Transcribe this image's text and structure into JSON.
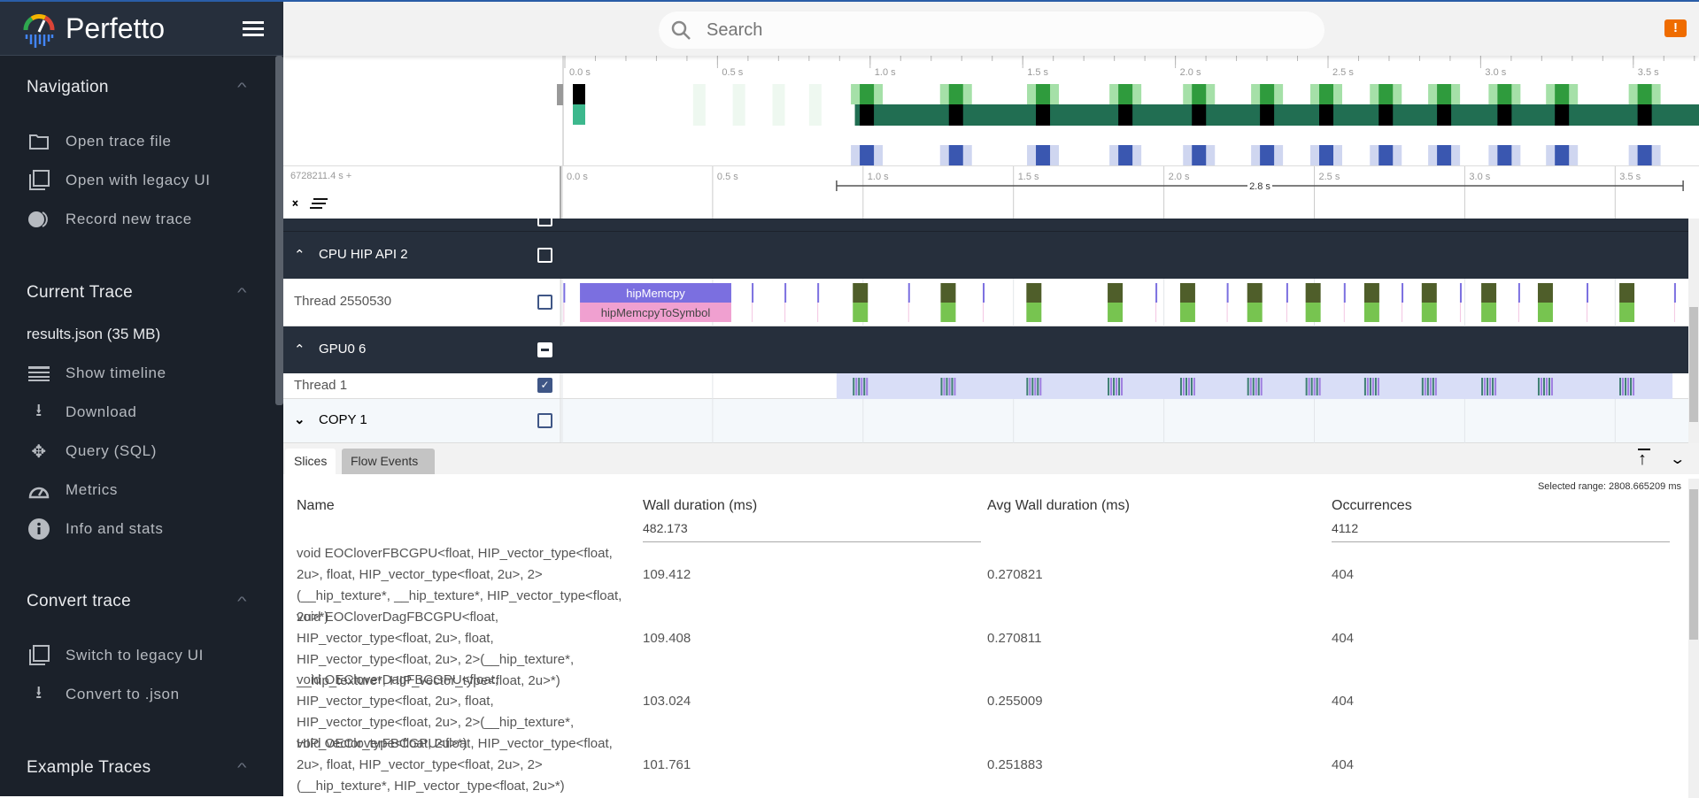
{
  "app": {
    "title": "Perfetto",
    "search_placeholder": "Search",
    "alert_icon": "alert-icon"
  },
  "colors": {
    "sidebar_bg": "#1b212a",
    "track_header_bg": "#262f3c",
    "accent": "#2a5ea8",
    "alert": "#ef6c00",
    "slice_purple": "#7b6fe0",
    "slice_pink": "#f0a0d0",
    "slice_olive": "#4f5e2a",
    "slice_green": "#77c450",
    "overview_teal": "#216e52",
    "overview_blue": "#3a57b0"
  },
  "sidebar": {
    "sections": [
      {
        "title": "Navigation",
        "items": [
          {
            "label": "Open trace file",
            "icon": "folder-icon"
          },
          {
            "label": "Open with legacy UI",
            "icon": "copy-icon"
          },
          {
            "label": "Record new trace",
            "icon": "record-icon"
          }
        ]
      },
      {
        "title": "Current Trace",
        "subtitle": "results.json (35 MB)",
        "items": [
          {
            "label": "Show timeline",
            "icon": "timeline-icon"
          },
          {
            "label": "Download",
            "icon": "download-icon"
          },
          {
            "label": "Query (SQL)",
            "icon": "query-icon"
          },
          {
            "label": "Metrics",
            "icon": "speedometer-icon"
          },
          {
            "label": "Info and stats",
            "icon": "info-icon"
          }
        ]
      },
      {
        "title": "Convert trace",
        "items": [
          {
            "label": "Switch to legacy UI",
            "icon": "copy-icon"
          },
          {
            "label": "Convert to .json",
            "icon": "download-icon"
          }
        ]
      },
      {
        "title": "Example Traces",
        "items": []
      }
    ]
  },
  "timeline": {
    "offset_label": "6728211.4 s +",
    "ticks": [
      "0.0 s",
      "0.5 s",
      "1.0 s",
      "1.5 s",
      "2.0 s",
      "2.5 s",
      "3.0 s",
      "3.5 s"
    ],
    "selection_label": "2.8 s",
    "selection_range_s": [
      0.912,
      3.726
    ],
    "tracks": [
      {
        "name": "CPU HIP API 2",
        "type": "group",
        "expanded": true,
        "checked": false
      },
      {
        "name": "Thread 2550530",
        "type": "thread",
        "checked": false
      },
      {
        "name": "GPU0 6",
        "type": "group",
        "expanded": true,
        "checked": "partial"
      },
      {
        "name": "Thread 1",
        "type": "thread",
        "checked": true
      },
      {
        "name": "COPY 1",
        "type": "group",
        "expanded": false,
        "checked": false
      }
    ],
    "thread_slices": {
      "main": [
        {
          "name": "hipMemcpy",
          "child": "hipMemcpyToSymbol",
          "start": 0.059,
          "end": 0.562
        }
      ],
      "kernel_starts": [
        0.966,
        1.258,
        1.543,
        1.813,
        2.054,
        2.277,
        2.471,
        2.666,
        2.857,
        3.055,
        3.243,
        3.514
      ],
      "kernel_duration": 0.05,
      "thin_marks": [
        0.004,
        0.63,
        0.739,
        0.848,
        1.15,
        1.398,
        1.972,
        2.209,
        2.407,
        2.598,
        2.79,
        2.984,
        3.178,
        3.405,
        3.696
      ]
    }
  },
  "panel": {
    "tabs": [
      "Slices",
      "Flow Events"
    ],
    "active_tab": 0,
    "selected_range": "Selected range: 2808.665209 ms",
    "columns": [
      "Name",
      "Wall duration (ms)",
      "Avg Wall duration (ms)",
      "Occurrences"
    ],
    "totals": [
      "",
      "482.173",
      "",
      "4112"
    ],
    "rows": [
      [
        "void EOCloverFBCGPU<float, HIP_vector_type<float, 2u>, float, HIP_vector_type<float, 2u>, 2>(__hip_texture*, __hip_texture*, HIP_vector_type<float, 2u>*)",
        "109.412",
        "0.270821",
        "404"
      ],
      [
        "void EOCloverDagFBCGPU<float, HIP_vector_type<float, 2u>, float, HIP_vector_type<float, 2u>, 2>(__hip_texture*, __hip_texture*, HIP_vector_type<float, 2u>*)",
        "109.408",
        "0.270811",
        "404"
      ],
      [
        "void OECloverDagFBCGPU<float, HIP_vector_type<float, 2u>, float, HIP_vector_type<float, 2u>, 2>(__hip_texture*, HIP_vector_type<float, 2u>*)",
        "103.024",
        "0.255009",
        "404"
      ],
      [
        "void OECloverFBCGPU<float, HIP_vector_type<float, 2u>, float, HIP_vector_type<float, 2u>, 2>(__hip_texture*, HIP_vector_type<float, 2u>*)",
        "101.761",
        "0.251883",
        "404"
      ]
    ]
  }
}
